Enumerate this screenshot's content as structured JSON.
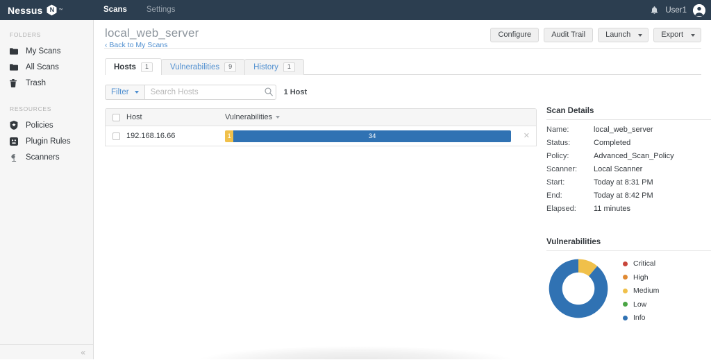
{
  "topnav": {
    "brand": "Nessus",
    "brand_mark": "N",
    "brand_tm": "™",
    "links": [
      {
        "label": "Scans",
        "active": true
      },
      {
        "label": "Settings",
        "active": false
      }
    ],
    "bell_icon": "bell-icon",
    "user": "User1",
    "avatar_icon": "user-avatar-icon"
  },
  "sidebar": {
    "folders_heading": "FOLDERS",
    "folders": [
      {
        "label": "My Scans",
        "icon": "folder-icon"
      },
      {
        "label": "All Scans",
        "icon": "folder-icon"
      },
      {
        "label": "Trash",
        "icon": "trash-icon"
      }
    ],
    "resources_heading": "RESOURCES",
    "resources": [
      {
        "label": "Policies",
        "icon": "shield-badge-icon"
      },
      {
        "label": "Plugin Rules",
        "icon": "plugin-square-icon"
      },
      {
        "label": "Scanners",
        "icon": "radar-icon"
      }
    ],
    "collapse_glyph": "«"
  },
  "page": {
    "title": "local_web_server",
    "breadcrumb": "Back to My Scans",
    "breadcrumb_glyph": "‹",
    "actions": [
      {
        "label": "Configure",
        "has_caret": false
      },
      {
        "label": "Audit Trail",
        "has_caret": false
      },
      {
        "label": "Launch",
        "has_caret": true
      },
      {
        "label": "Export",
        "has_caret": true
      }
    ]
  },
  "tabs": [
    {
      "label": "Hosts",
      "badge": "1",
      "active": true
    },
    {
      "label": "Vulnerabilities",
      "badge": "9",
      "active": false
    },
    {
      "label": "History",
      "badge": "1",
      "active": false
    }
  ],
  "toolbar": {
    "filter_label": "Filter",
    "search_placeholder": "Search Hosts",
    "search_value": "",
    "search_icon": "search-icon",
    "host_count": "1 Host"
  },
  "table": {
    "columns": [
      "Host",
      "Vulnerabilities"
    ],
    "rows": [
      {
        "host": "192.168.16.66",
        "segments": [
          {
            "severity": "Medium",
            "count": "1",
            "color": "#f0c04a",
            "width_pct": 3
          },
          {
            "severity": "Info",
            "count": "34",
            "color": "#3072b3",
            "width_pct": 97
          }
        ],
        "remove_glyph": "✕"
      }
    ]
  },
  "scan_details": {
    "title": "Scan Details",
    "fields": [
      {
        "label": "Name:",
        "value": "local_web_server"
      },
      {
        "label": "Status:",
        "value": "Completed"
      },
      {
        "label": "Policy:",
        "value": "Advanced_Scan_Policy"
      },
      {
        "label": "Scanner:",
        "value": "Local Scanner"
      },
      {
        "label": "Start:",
        "value": "Today at 8:31 PM"
      },
      {
        "label": "End:",
        "value": "Today at 8:42 PM"
      },
      {
        "label": "Elapsed:",
        "value": "11 minutes"
      }
    ]
  },
  "vulnerabilities": {
    "title": "Vulnerabilities",
    "legend": [
      {
        "label": "Critical",
        "color": "#c8453a"
      },
      {
        "label": "High",
        "color": "#e08a33"
      },
      {
        "label": "Medium",
        "color": "#f0c04a"
      },
      {
        "label": "Low",
        "color": "#4aa544"
      },
      {
        "label": "Info",
        "color": "#3072b3"
      }
    ]
  },
  "chart_data": {
    "type": "pie",
    "title": "Vulnerabilities",
    "labels": [
      "Critical",
      "High",
      "Medium",
      "Low",
      "Info"
    ],
    "values": [
      0,
      0,
      1,
      0,
      8
    ],
    "colors": [
      "#c8453a",
      "#e08a33",
      "#f0c04a",
      "#4aa544",
      "#3072b3"
    ],
    "donut": true,
    "inner_radius_ratio": 0.55,
    "start_angle_deg": -90,
    "legend_position": "right"
  }
}
